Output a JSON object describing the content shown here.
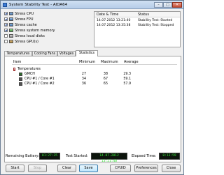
{
  "window": {
    "title": "System Stability Test - AIDA64",
    "minimize": "–",
    "maximize": "□",
    "close": "✕"
  },
  "stress_options": [
    {
      "label": "Stress CPU",
      "checked": true,
      "icon": "cpu-icon"
    },
    {
      "label": "Stress FPU",
      "checked": true,
      "icon": "fpu-icon"
    },
    {
      "label": "Stress cache",
      "checked": true,
      "icon": "cache-icon"
    },
    {
      "label": "Stress system memory",
      "checked": true,
      "icon": "memory-icon"
    },
    {
      "label": "Stress local disks",
      "checked": false,
      "icon": "disk-icon"
    },
    {
      "label": "Stress GPU(s)",
      "checked": false,
      "icon": "gpu-icon"
    }
  ],
  "log": {
    "headers": {
      "datetime": "Date & Time",
      "status": "Status"
    },
    "rows": [
      {
        "datetime": "14.07.2012 13:21:40",
        "status": "Stability Test: Started"
      },
      {
        "datetime": "14.07.2012 13:35:38",
        "status": "Stability Test: Stopped"
      }
    ]
  },
  "tabs": [
    "Temperatures",
    "Cooling Fans",
    "Voltages",
    "Statistics"
  ],
  "active_tab": "Statistics",
  "stats": {
    "headers": {
      "item": "Item",
      "minimum": "Minimum",
      "maximum": "Maximum",
      "average": "Average"
    },
    "group": "Temperatures",
    "rows": [
      {
        "name": "GMCH",
        "min": "27",
        "max": "38",
        "avg": "29.3"
      },
      {
        "name": "CPU #1 / Core #1",
        "min": "34",
        "max": "67",
        "avg": "59.1"
      },
      {
        "name": "CPU #1 / Core #2",
        "min": "36",
        "max": "65",
        "avg": "57.9"
      }
    ]
  },
  "status": {
    "battery_label": "Remaining Battery:",
    "battery_value": "01:27:35",
    "started_label": "Test Started:",
    "started_value": "14.07.2012 13:21:40",
    "elapsed_label": "Elapsed Time:",
    "elapsed_value": "0:13:59"
  },
  "buttons": {
    "start": "Start",
    "stop": "Stop",
    "clear": "Clear",
    "save": "Save",
    "cpuid": "CPUID",
    "preferences": "Preferences",
    "close": "Close"
  }
}
